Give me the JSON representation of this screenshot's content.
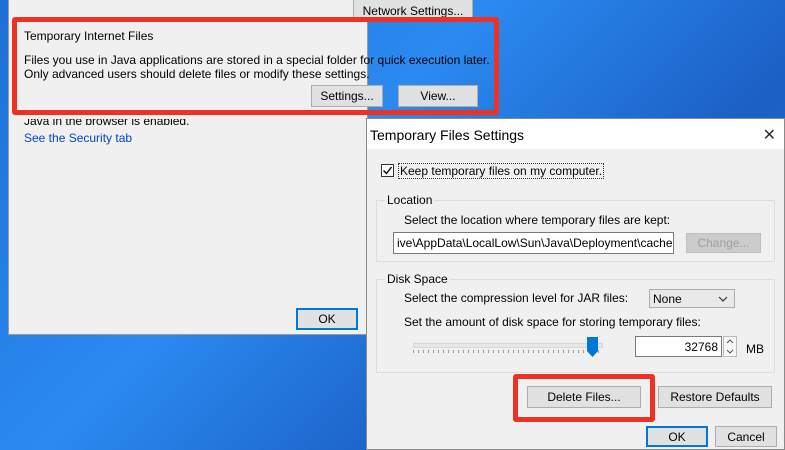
{
  "back_window": {
    "network_settings_label": "Network Settings...",
    "temp_files_group_title": "Temporary Internet Files",
    "temp_files_desc_line1": "Files you use in Java applications are stored in a special folder for quick execution later.",
    "temp_files_desc_line2": "Only advanced users should delete files or modify these settings.",
    "settings_label": "Settings...",
    "view_label": "View...",
    "browser_status": "Java in the browser is enabled.",
    "security_link": "See the Security tab",
    "ok_label": "OK"
  },
  "dialog": {
    "title": "Temporary Files Settings",
    "close_glyph": "✕",
    "keep_files_label": "Keep temporary files on my computer.",
    "keep_files_checked": true,
    "location_group_title": "Location",
    "location_desc": "Select the location where temporary files are kept:",
    "location_path": "ive\\AppData\\LocalLow\\Sun\\Java\\Deployment\\cache",
    "change_label": "Change...",
    "disk_group_title": "Disk Space",
    "compression_label": "Select the compression level for JAR files:",
    "compression_value": "None",
    "disk_amount_label": "Set the amount of disk space for storing temporary files:",
    "disk_value": "32768",
    "disk_unit": "MB",
    "slider_fraction": 0.97,
    "delete_files_label": "Delete Files...",
    "restore_defaults_label": "Restore Defaults",
    "ok_label": "OK",
    "cancel_label": "Cancel"
  },
  "colors": {
    "highlight": "#ef3124",
    "accent": "#0078d7"
  }
}
